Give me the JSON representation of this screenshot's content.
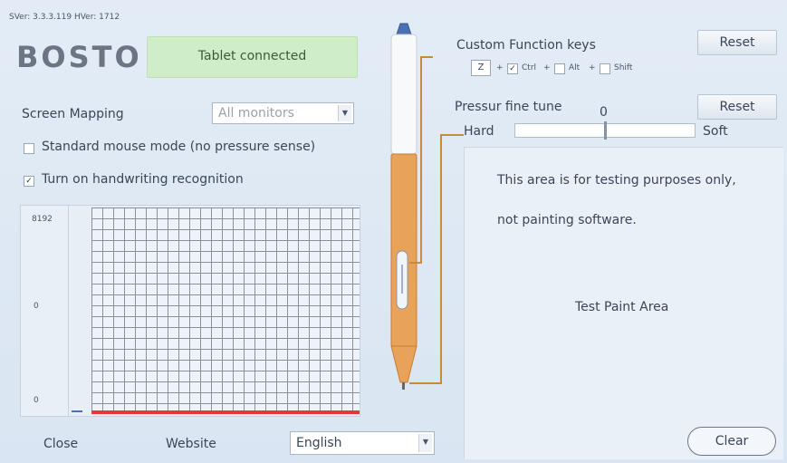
{
  "version_text": "SVer: 3.3.3.119  HVer: 1712",
  "brand": "BOSTO",
  "status": {
    "text": "Tablet connected",
    "color": "#cfeec7"
  },
  "screen_mapping": {
    "label": "Screen Mapping",
    "selected": "All monitors"
  },
  "standard_mouse": {
    "label": "Standard mouse mode (no pressure sense)",
    "checked": false
  },
  "handwriting": {
    "label": "Turn on handwriting recognition",
    "checked": true
  },
  "pressure_graph": {
    "y_labels": [
      "8192",
      "0",
      "0"
    ]
  },
  "custom_keys": {
    "title": "Custom Function keys",
    "reset": "Reset",
    "key": "Z",
    "plus": "+",
    "ctrl": {
      "label": "Ctrl",
      "checked": true
    },
    "alt": {
      "label": "Alt",
      "checked": false
    },
    "shift": {
      "label": "Shift",
      "checked": false
    }
  },
  "pressure_tune": {
    "title": "Pressur fine tune",
    "value": "0",
    "reset": "Reset",
    "hard": "Hard",
    "soft": "Soft",
    "position": 0.5
  },
  "test_area": {
    "line1": "This area is for testing purposes only,",
    "line2": "not painting software.",
    "center": "Test Paint Area",
    "clear": "Clear"
  },
  "footer": {
    "close": "Close",
    "website": "Website",
    "language": "English"
  },
  "icons": {
    "dropdown": "chevron-down-icon",
    "check": "check-icon"
  },
  "colors": {
    "pen_orange": "#e8a25a",
    "baseline_red": "#e23a3a",
    "accent_blue": "#4d6fb3"
  }
}
